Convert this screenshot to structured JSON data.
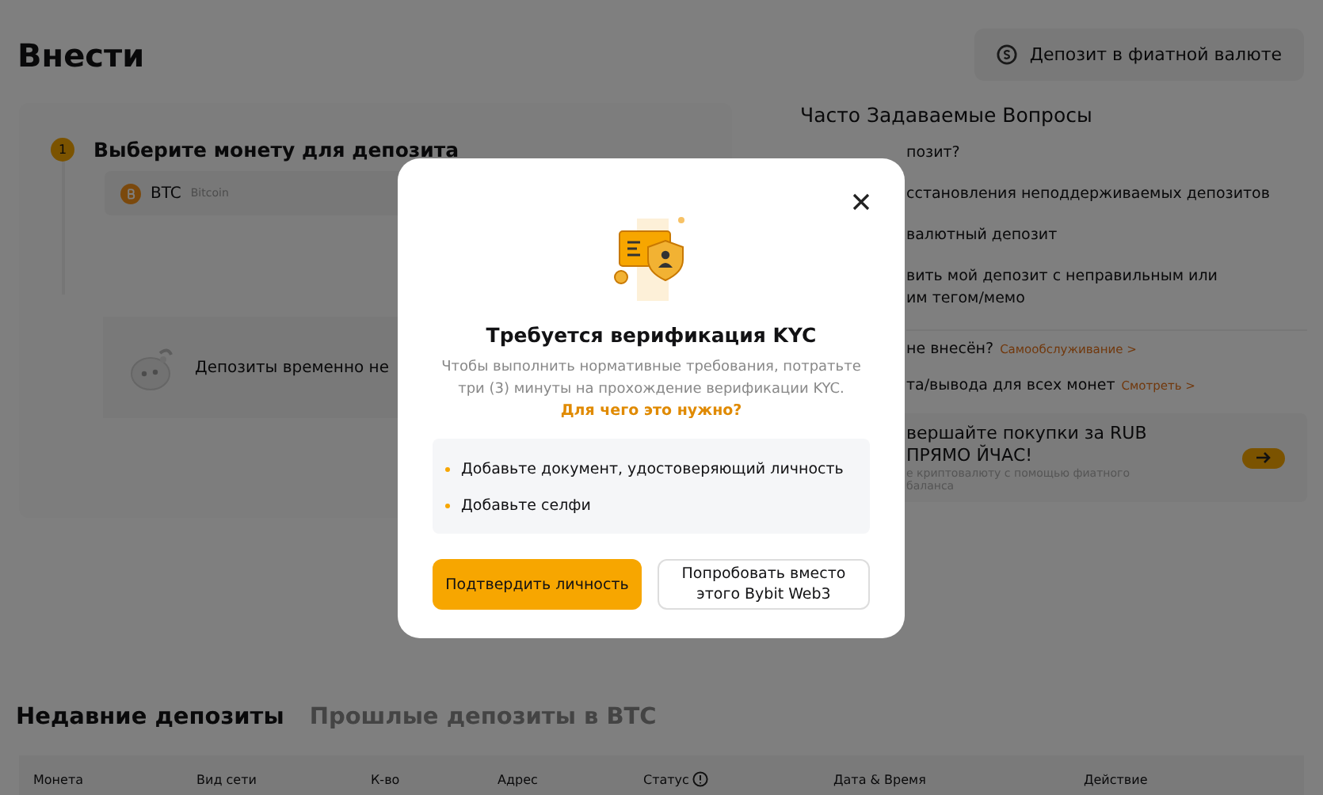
{
  "page": {
    "title": "Внести",
    "fiat_button": "Депозит в фиатной валюте"
  },
  "deposit_card": {
    "step_number": "1",
    "step_title": "Выберите монету для депозита",
    "coin": {
      "symbol": "BTC",
      "name": "Bitcoin"
    },
    "notice": "Депозиты временно не"
  },
  "faq": {
    "title": "Часто Задаваемые Вопросы",
    "items": [
      {
        "lines": [
          "позит?"
        ]
      },
      {
        "lines": [
          "сстановления неподдерживаемых депозитов"
        ]
      },
      {
        "lines": [
          "валютный депозит"
        ]
      },
      {
        "lines": [
          "вить мой депозит с неправильным или",
          "им тегом/мемо"
        ]
      }
    ],
    "help_rows": [
      {
        "text": "не внесён?",
        "link": "Самообслуживание >"
      },
      {
        "text": "та/вывода для всех монет",
        "link": "Смотреть >"
      }
    ],
    "promo": {
      "title": "вершайте покупки за RUB ПРЯМО ЙЧАС!",
      "subtitle": "е криптовалюту с помощью фиатного баланса"
    }
  },
  "history": {
    "tabs": [
      {
        "label": "Недавние депозиты",
        "selected": true
      },
      {
        "label": "Прошлые депозиты в BTC",
        "selected": false
      }
    ],
    "columns": [
      {
        "label": "Монета",
        "kind": "plain"
      },
      {
        "label": "Вид сети",
        "kind": "plain"
      },
      {
        "label": "К-во",
        "kind": "plain"
      },
      {
        "label": "Адрес",
        "kind": "plain"
      },
      {
        "label": "Статус",
        "kind": "info"
      },
      {
        "label": "Дата & Время",
        "kind": "plain"
      },
      {
        "label": "Действие",
        "kind": "plain"
      }
    ]
  },
  "modal": {
    "title": "Требуется верификация KYC",
    "description": "Чтобы выполнить нормативные требования, потратьте три (3) минуты на прохождение верификации KYC.",
    "link": "Для чего это нужно?",
    "requirements": [
      "Добавьте документ, удостоверяющий личность",
      "Добавьте селфи"
    ],
    "buttons": [
      {
        "label": "Подтвердить личность",
        "kind": "primary"
      },
      {
        "label": "Попробовать вместо этого Bybit Web3",
        "kind": "secondary"
      }
    ]
  }
}
